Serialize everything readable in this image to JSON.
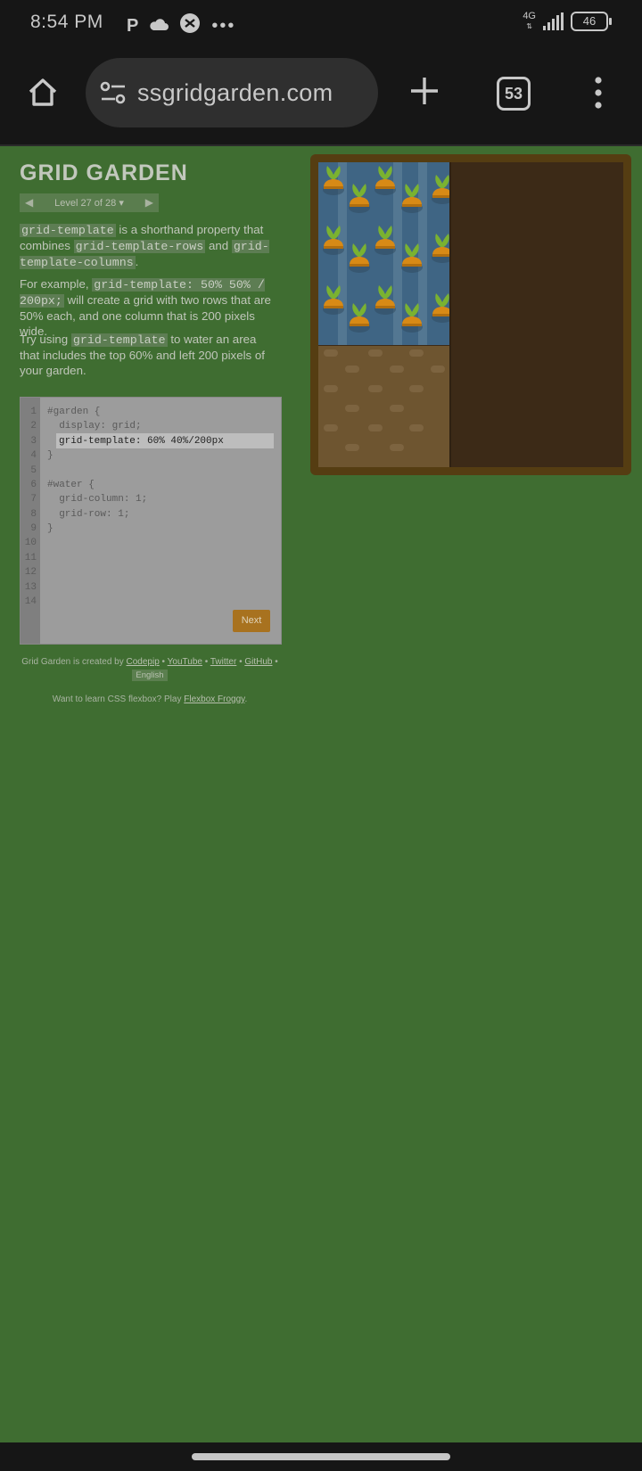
{
  "status_bar": {
    "time": "8:54 PM",
    "network": "4G",
    "battery": "46",
    "overflow": "•••"
  },
  "browser": {
    "url": "cssgridgarden.com",
    "url_visible": "ssgridgarden.com",
    "tab_count": "53",
    "icons": [
      "home-icon",
      "tune-icon",
      "plus-icon",
      "tabs-icon",
      "more-vert-icon"
    ]
  },
  "page": {
    "title": "GRID GARDEN",
    "level_label": "Level 27 of 28",
    "level_marker": "▾",
    "instructions": {
      "p1_code1": "grid-template",
      "p1_text1": " is a shorthand property that combines ",
      "p1_code2": "grid-template-rows",
      "p1_text2": " and ",
      "p1_code3": "grid-template-columns",
      "p1_text3": ".",
      "p2_text1": "For example, ",
      "p2_code1": "grid-template: 50% 50% / 200px;",
      "p2_text2": " will create a grid with two rows that are 50% each, and one column that is 200 pixels wide.",
      "p3_text1": "Try using ",
      "p3_code1": "grid-template",
      "p3_text2": " to water an area that includes the top 60% and left 200 pixels of your garden."
    },
    "editor": {
      "line_numbers": [
        "1",
        "2",
        "3",
        "4",
        "5",
        "6",
        "7",
        "8",
        "9",
        "10",
        "11",
        "12",
        "13",
        "14"
      ],
      "line1": "#garden {",
      "line2": "  display: grid;",
      "input_value": "grid-template: 60% 40%/200px",
      "line4": "}",
      "line6": "#water {",
      "line7": "  grid-column: 1;",
      "line8": "  grid-row: 1;",
      "line9": "}",
      "next_label": "Next"
    },
    "credits": {
      "prefix": "Grid Garden is created by ",
      "codepip": "Codepip",
      "youtube": "YouTube",
      "twitter": "Twitter",
      "github": "GitHub",
      "sep": " • ",
      "language": "English"
    },
    "promo": {
      "text": "Want to learn CSS flexbox? Play ",
      "link": "Flexbox Froggy",
      "end": "."
    }
  },
  "colors": {
    "page_bg": "#3f6d31",
    "water": "#3f6584",
    "soil": "#3c2a17",
    "next_button": "#a8721f"
  }
}
